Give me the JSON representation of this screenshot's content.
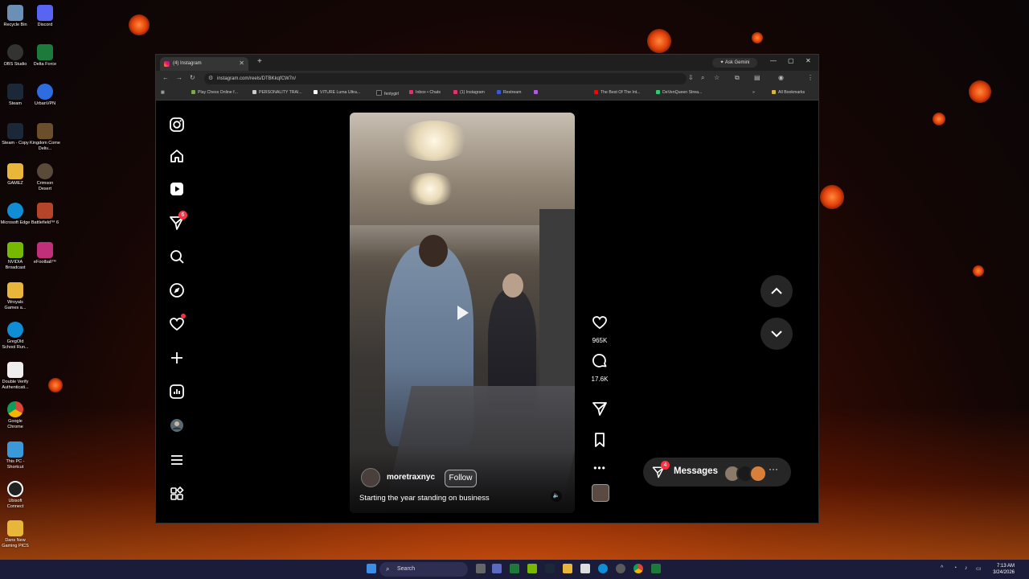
{
  "desktop": {
    "icons": [
      {
        "label": "Recycle Bin",
        "color": "#6b8fb5"
      },
      {
        "label": "Discord",
        "color": "#5865f2"
      },
      {
        "label": "OBS Studio",
        "color": "#333333"
      },
      {
        "label": "Delta Force",
        "color": "#1c7a3a"
      },
      {
        "label": "Steam",
        "color": "#1b2838"
      },
      {
        "label": "UrbanVPN",
        "color": "#2d6de0"
      },
      {
        "label": "Steam - Copy",
        "color": "#1b2838"
      },
      {
        "label": "Kingdom Come Deliv...",
        "color": "#6b4f2a"
      },
      {
        "label": "GAMEZ",
        "color": "#e8b73a"
      },
      {
        "label": "Crimson Desert",
        "color": "#5a4a3a"
      },
      {
        "label": "Microsoft Edge",
        "color": "#0f8ed6"
      },
      {
        "label": "Battlefield™ 6",
        "color": "#b5442a"
      },
      {
        "label": "NVIDIA Broadcast",
        "color": "#76b900"
      },
      {
        "label": "eFootball™",
        "color": "#c0307a"
      },
      {
        "label": "Wroyals Games a...",
        "color": "#e8b73a"
      },
      {
        "label": "GregOld School Run...",
        "color": "#0f8ed6"
      },
      {
        "label": "Double Verify Authenticati...",
        "color": "#eeeeee"
      },
      {
        "label": "Google Chrome",
        "color": "#db4437"
      },
      {
        "label": "This PC - Shortcut",
        "color": "#3a9ad9"
      },
      {
        "label": "Ubisoft Connect",
        "color": "#222222"
      },
      {
        "label": "Dans New Gaming PICS",
        "color": "#e8b73a"
      }
    ]
  },
  "browser": {
    "tab_title": "(4) Instagram",
    "ask_gemini": "Ask Gemini",
    "url": "instagram.com/reels/DTBKkqfCW7n/",
    "bookmarks": [
      {
        "label": "Play Chess Online f...",
        "color": "#7fa650"
      },
      {
        "label": "PERSONALITY TRAI...",
        "color": "#cccccc"
      },
      {
        "label": "VITURE Luma Ultra...",
        "color": "#ffffff"
      },
      {
        "label": "fentygirl",
        "color": "#222222"
      },
      {
        "label": "Inbox • Chats",
        "color": "#e1306c"
      },
      {
        "label": "(1) Instagram",
        "color": "#e1306c"
      },
      {
        "label": "Restream",
        "color": "#3a5bd9"
      },
      {
        "label": "The Best Of The Int...",
        "color": "#ff0000"
      },
      {
        "label": "DeVenQueen Strea...",
        "color": "#2ecc71"
      }
    ],
    "all_bookmarks": "All Bookmarks"
  },
  "instagram": {
    "notif_badge": "6",
    "reel": {
      "username": "moretraxnyc",
      "follow_label": "Follow",
      "caption": "Starting the year standing on business"
    },
    "actions": {
      "likes": "965K",
      "comments": "17.6K"
    },
    "messages": {
      "label": "Messages",
      "badge": "4"
    }
  },
  "taskbar": {
    "search_placeholder": "Search",
    "time": "7:13 AM",
    "date": "3/24/2026"
  }
}
